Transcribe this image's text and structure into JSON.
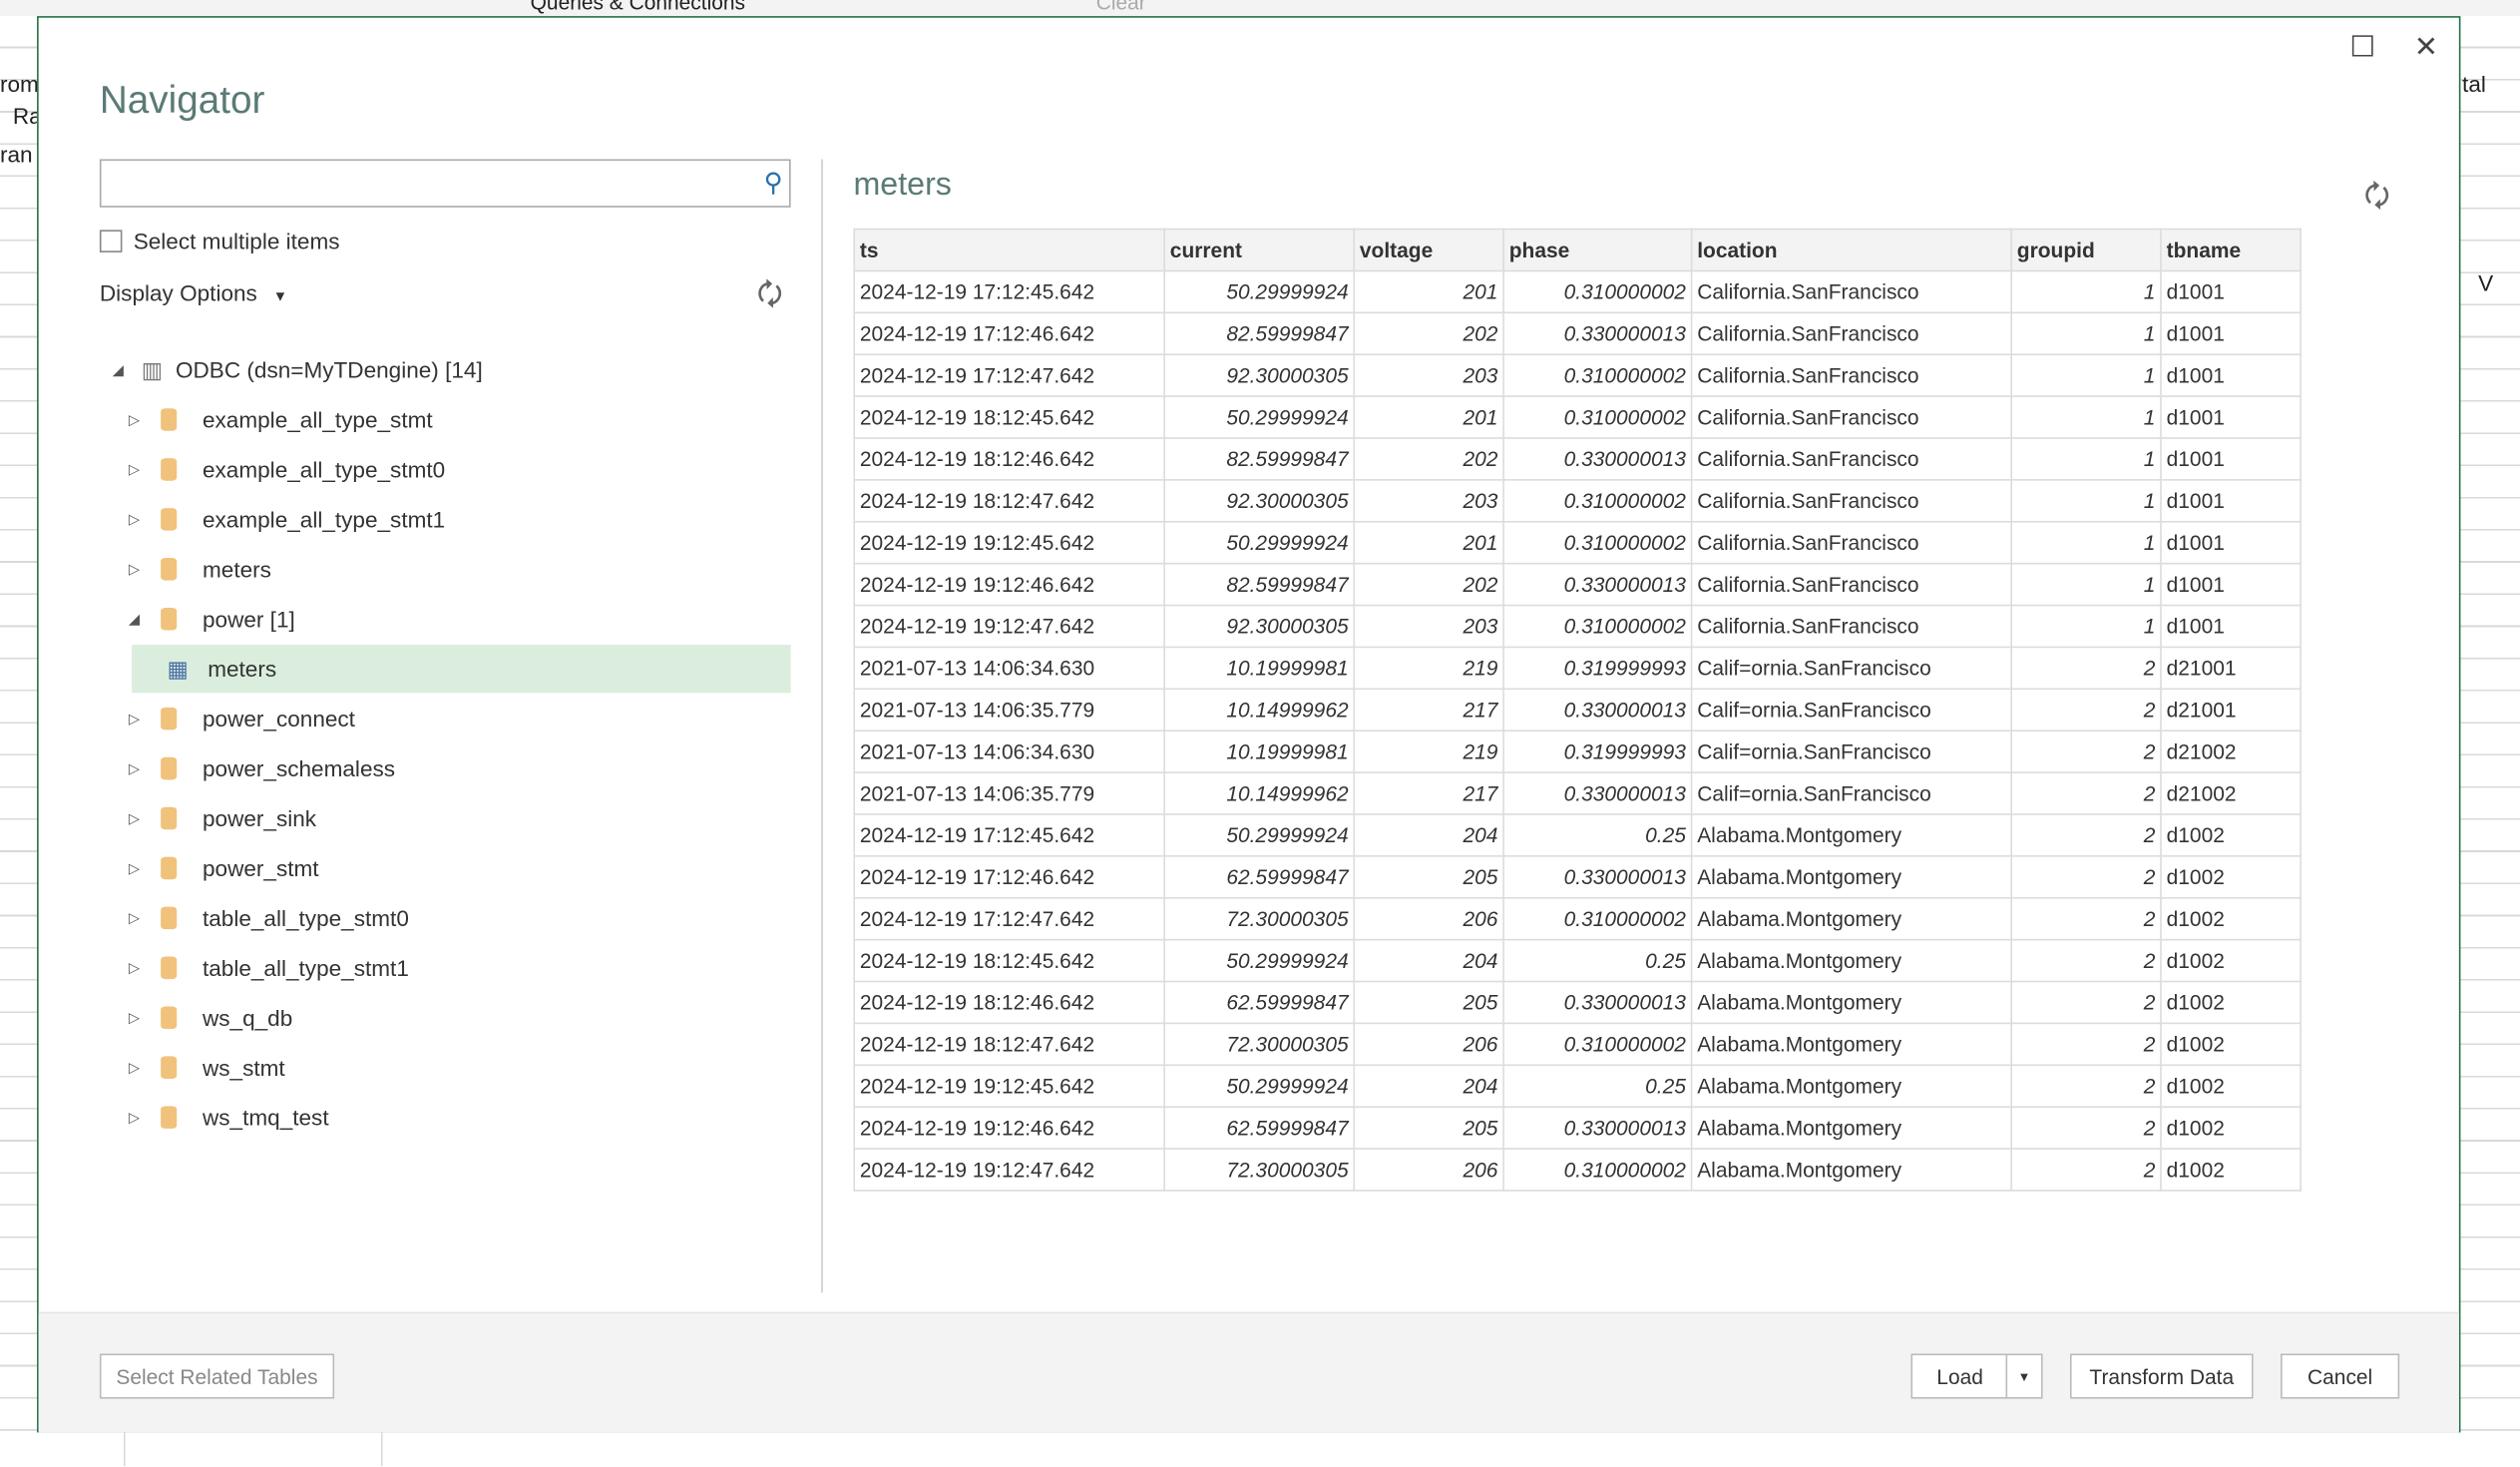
{
  "excel": {
    "ribbon_queries": "Queries & Connections",
    "ribbon_clear": "Clear",
    "left_frag": [
      "rom",
      "Ra",
      "ran"
    ],
    "right_frag": "tal",
    "col_v": "V"
  },
  "dialog": {
    "title": "Navigator",
    "maximize": "☐",
    "close": "✕"
  },
  "search": {
    "value": "",
    "placeholder": ""
  },
  "select_multiple": "Select multiple items",
  "display_options": "Display Options",
  "tree": {
    "root": "ODBC (dsn=MyTDengine) [14]",
    "items": [
      "example_all_type_stmt",
      "example_all_type_stmt0",
      "example_all_type_stmt1",
      "meters",
      "power [1]",
      "power_connect",
      "power_schemaless",
      "power_sink",
      "power_stmt",
      "table_all_type_stmt0",
      "table_all_type_stmt1",
      "ws_q_db",
      "ws_stmt",
      "ws_tmq_test"
    ],
    "child": "meters"
  },
  "preview": {
    "title": "meters",
    "columns": [
      "ts",
      "current",
      "voltage",
      "phase",
      "location",
      "groupid",
      "tbname"
    ],
    "rows": [
      [
        "2024-12-19 17:12:45.642",
        "50.29999924",
        "201",
        "0.310000002",
        "California.SanFrancisco",
        "1",
        "d1001"
      ],
      [
        "2024-12-19 17:12:46.642",
        "82.59999847",
        "202",
        "0.330000013",
        "California.SanFrancisco",
        "1",
        "d1001"
      ],
      [
        "2024-12-19 17:12:47.642",
        "92.30000305",
        "203",
        "0.310000002",
        "California.SanFrancisco",
        "1",
        "d1001"
      ],
      [
        "2024-12-19 18:12:45.642",
        "50.29999924",
        "201",
        "0.310000002",
        "California.SanFrancisco",
        "1",
        "d1001"
      ],
      [
        "2024-12-19 18:12:46.642",
        "82.59999847",
        "202",
        "0.330000013",
        "California.SanFrancisco",
        "1",
        "d1001"
      ],
      [
        "2024-12-19 18:12:47.642",
        "92.30000305",
        "203",
        "0.310000002",
        "California.SanFrancisco",
        "1",
        "d1001"
      ],
      [
        "2024-12-19 19:12:45.642",
        "50.29999924",
        "201",
        "0.310000002",
        "California.SanFrancisco",
        "1",
        "d1001"
      ],
      [
        "2024-12-19 19:12:46.642",
        "82.59999847",
        "202",
        "0.330000013",
        "California.SanFrancisco",
        "1",
        "d1001"
      ],
      [
        "2024-12-19 19:12:47.642",
        "92.30000305",
        "203",
        "0.310000002",
        "California.SanFrancisco",
        "1",
        "d1001"
      ],
      [
        "2021-07-13 14:06:34.630",
        "10.19999981",
        "219",
        "0.319999993",
        "Calif=ornia.SanFrancisco",
        "2",
        "d21001"
      ],
      [
        "2021-07-13 14:06:35.779",
        "10.14999962",
        "217",
        "0.330000013",
        "Calif=ornia.SanFrancisco",
        "2",
        "d21001"
      ],
      [
        "2021-07-13 14:06:34.630",
        "10.19999981",
        "219",
        "0.319999993",
        "Calif=ornia.SanFrancisco",
        "2",
        "d21002"
      ],
      [
        "2021-07-13 14:06:35.779",
        "10.14999962",
        "217",
        "0.330000013",
        "Calif=ornia.SanFrancisco",
        "2",
        "d21002"
      ],
      [
        "2024-12-19 17:12:45.642",
        "50.29999924",
        "204",
        "0.25",
        "Alabama.Montgomery",
        "2",
        "d1002"
      ],
      [
        "2024-12-19 17:12:46.642",
        "62.59999847",
        "205",
        "0.330000013",
        "Alabama.Montgomery",
        "2",
        "d1002"
      ],
      [
        "2024-12-19 17:12:47.642",
        "72.30000305",
        "206",
        "0.310000002",
        "Alabama.Montgomery",
        "2",
        "d1002"
      ],
      [
        "2024-12-19 18:12:45.642",
        "50.29999924",
        "204",
        "0.25",
        "Alabama.Montgomery",
        "2",
        "d1002"
      ],
      [
        "2024-12-19 18:12:46.642",
        "62.59999847",
        "205",
        "0.330000013",
        "Alabama.Montgomery",
        "2",
        "d1002"
      ],
      [
        "2024-12-19 18:12:47.642",
        "72.30000305",
        "206",
        "0.310000002",
        "Alabama.Montgomery",
        "2",
        "d1002"
      ],
      [
        "2024-12-19 19:12:45.642",
        "50.29999924",
        "204",
        "0.25",
        "Alabama.Montgomery",
        "2",
        "d1002"
      ],
      [
        "2024-12-19 19:12:46.642",
        "62.59999847",
        "205",
        "0.330000013",
        "Alabama.Montgomery",
        "2",
        "d1002"
      ],
      [
        "2024-12-19 19:12:47.642",
        "72.30000305",
        "206",
        "0.310000002",
        "Alabama.Montgomery",
        "2",
        "d1002"
      ]
    ]
  },
  "footer": {
    "select_related": "Select Related Tables",
    "load": "Load",
    "transform": "Transform Data",
    "cancel": "Cancel"
  }
}
